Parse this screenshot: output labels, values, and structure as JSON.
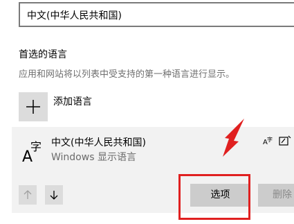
{
  "language_dropdown": {
    "value": "中文(中华人民共和国)"
  },
  "preferred": {
    "title": "首选的语言",
    "description": "应用和网站将以列表中受支持的第一种语言进行显示。",
    "add_label": "添加语言"
  },
  "language_card": {
    "name": "中文(中华人民共和国)",
    "subtitle": "Windows 显示语言",
    "options_label": "选项",
    "remove_label": "删除"
  },
  "colors": {
    "highlight": "#e02020",
    "card_bg": "#f2f2f2",
    "button_bg": "#cccccc"
  }
}
